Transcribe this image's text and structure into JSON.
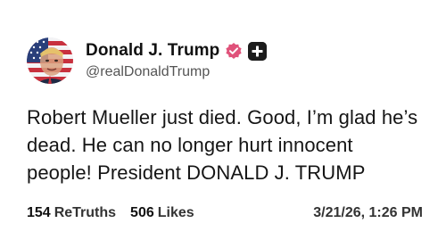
{
  "post": {
    "author": {
      "display_name": "Donald J. Trump",
      "handle": "@realDonaldTrump",
      "avatar_icon": "flag-portrait-avatar",
      "verified_icon": "verified-badge-icon",
      "verified_color": "#e0527a",
      "badge_icon": "plus-badge-icon"
    },
    "text_lines": [
      "Robert Mueller just died. Good, I’m glad he’s",
      "dead. He can no longer hurt innocent",
      "people! President DONALD J. TRUMP"
    ],
    "stats": {
      "retruths_count": "154",
      "retruths_label": "ReTruths",
      "likes_count": "506",
      "likes_label": "Likes"
    },
    "timestamp": "3/21/26, 1:26 PM"
  }
}
